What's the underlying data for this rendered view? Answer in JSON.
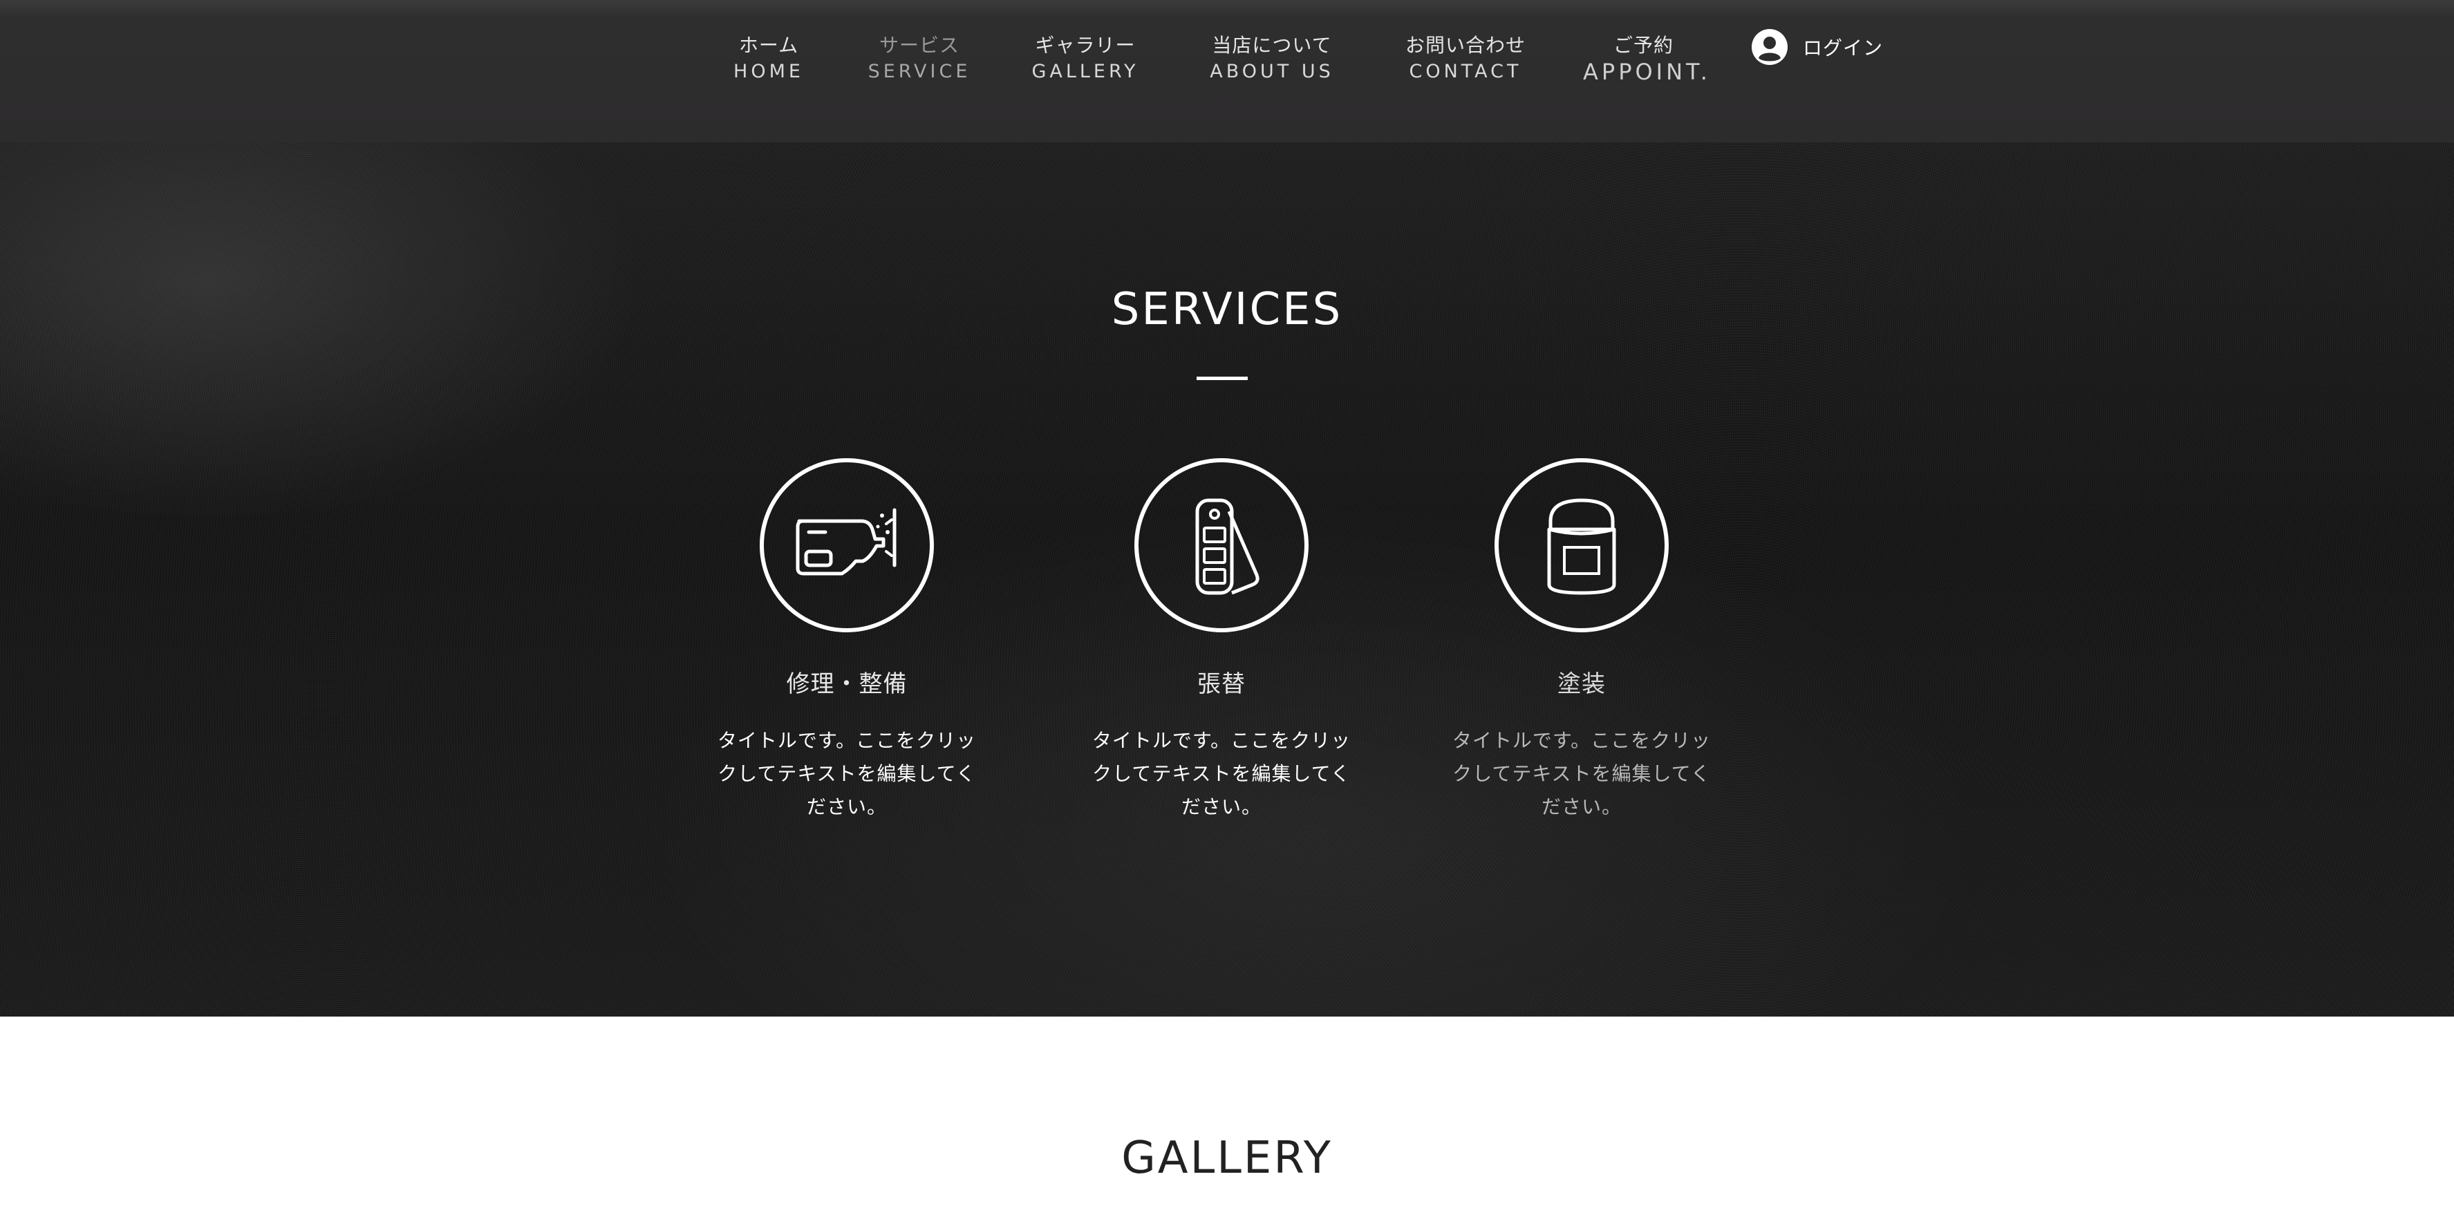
{
  "nav": {
    "items": [
      {
        "jp": "ホーム",
        "en": "HOME"
      },
      {
        "jp": "サービス",
        "en": "SERVICE"
      },
      {
        "jp": "ギャラリー",
        "en": "GALLERY"
      },
      {
        "jp": "当店について",
        "en": "ABOUT US"
      },
      {
        "jp": "お問い合わせ",
        "en": "CONTACT"
      },
      {
        "jp": "ご予約",
        "en": "APPOINT."
      }
    ],
    "login_label": "ログイン"
  },
  "services": {
    "title": "SERVICES",
    "cards": [
      {
        "title": "修理・整備",
        "desc": "タイトルです。ここをクリックしてテキストを編集してください。",
        "icon": "paint-spray-gun-icon"
      },
      {
        "title": "張替",
        "desc": "タイトルです。ここをクリックしてテキストを編集してください。",
        "icon": "color-swatch-icon"
      },
      {
        "title": "塗装",
        "desc": "タイトルです。ここをクリックしてテキストを編集してください。",
        "icon": "paint-bucket-icon"
      }
    ]
  },
  "gallery": {
    "title": "GALLERY"
  },
  "colors": {
    "header_bg": "#2d2c2d",
    "services_bg": "#161616",
    "accent_white": "#ffffff"
  }
}
